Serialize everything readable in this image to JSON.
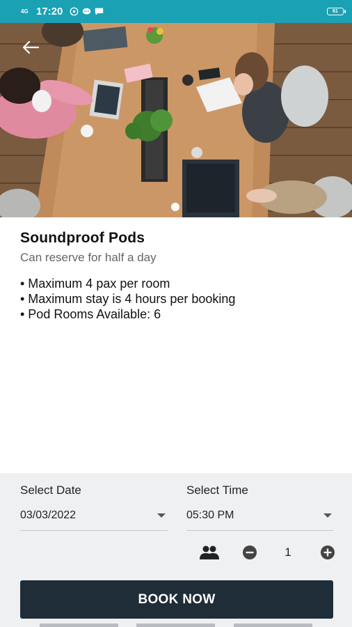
{
  "status_bar": {
    "network": "4G",
    "time": "17:20",
    "battery": "61",
    "app_icons": [
      "whatsapp-icon",
      "chat-icon",
      "message-icon"
    ]
  },
  "hero": {
    "alt": "Coworking table with people working on laptops",
    "carousel": {
      "current": 1,
      "total": 1
    }
  },
  "pod": {
    "title": "Soundproof Pods",
    "subtitle": "Can reserve for half a day",
    "features": [
      "• Maximum 4 pax per room",
      "• Maximum stay is 4 hours per booking",
      "• Pod Rooms Available: 6"
    ]
  },
  "booking": {
    "date_label": "Select Date",
    "date_value": "03/03/2022",
    "time_label": "Select Time",
    "time_value": "05:30 PM",
    "pax_count": "1",
    "book_label": "BOOK NOW"
  },
  "colors": {
    "status_bar": "#1aa1b4",
    "button": "#1e2d38",
    "panel": "#eff0f2"
  }
}
